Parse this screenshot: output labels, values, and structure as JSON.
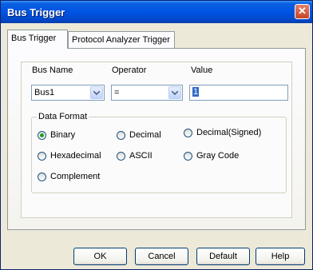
{
  "window": {
    "title": "Bus Trigger",
    "close_glyph": "✕"
  },
  "tabs": [
    {
      "label": "Bus Trigger",
      "active": true
    },
    {
      "label": "Protocol Analyzer Trigger",
      "active": false
    }
  ],
  "fields": {
    "bus_name": {
      "label": "Bus Name",
      "value": "Bus1"
    },
    "operator": {
      "label": "Operator",
      "value": "="
    },
    "value": {
      "label": "Value",
      "value": "1"
    }
  },
  "data_format": {
    "legend": "Data Format",
    "selected": "Binary",
    "options": [
      "Binary",
      "Decimal",
      "Decimal(Signed)",
      "Hexadecimal",
      "ASCII",
      "Gray Code",
      "Complement"
    ]
  },
  "buttons": {
    "ok": "OK",
    "cancel": "Cancel",
    "default": "Default",
    "help": "Help"
  },
  "colors": {
    "titlebar": "#0054e3",
    "face": "#ece9d8",
    "selected_radio": "#21a121"
  }
}
